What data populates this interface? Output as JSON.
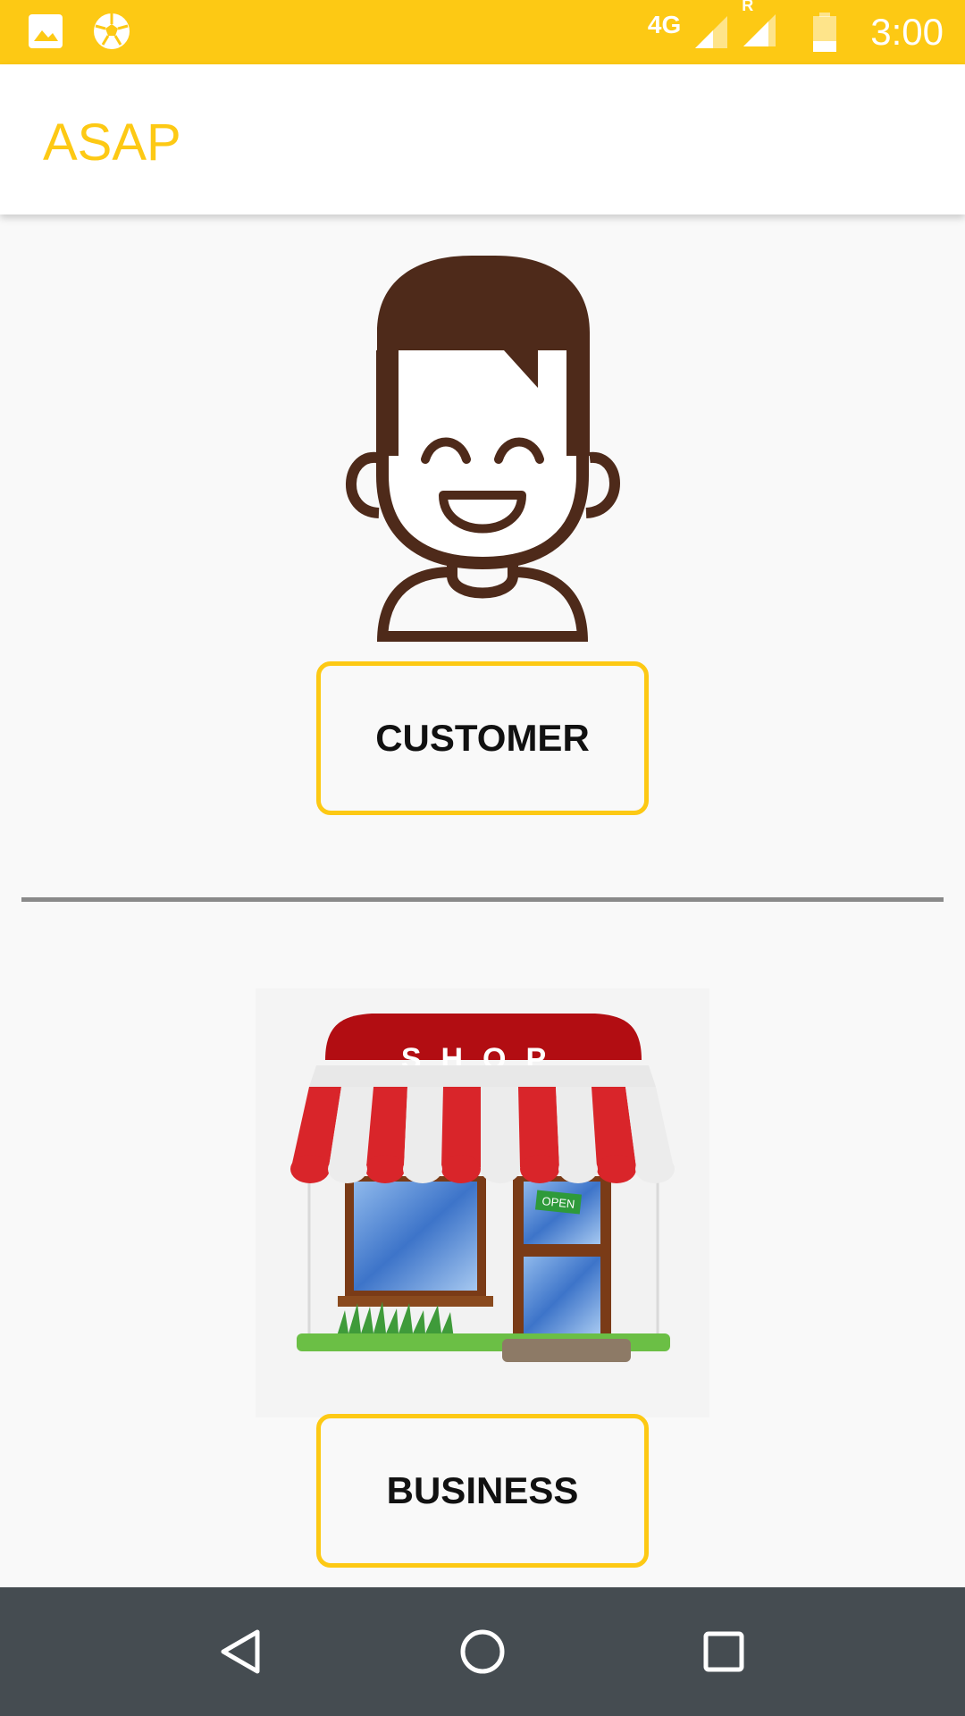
{
  "status_bar": {
    "network": "4G",
    "roaming": "R",
    "time": "3:00",
    "icons": [
      "image-icon",
      "soccer-ball-icon",
      "signal-icon",
      "roaming-signal-icon",
      "battery-icon"
    ]
  },
  "app_bar": {
    "title": "ASAP"
  },
  "customer": {
    "button_label": "CUSTOMER",
    "image": "customer-avatar-icon"
  },
  "business": {
    "button_label": "BUSINESS",
    "image": "shop-storefront-icon",
    "sign_text": "SHOP",
    "door_sign": "OPEN"
  },
  "nav_bar": {
    "buttons": [
      "back-icon",
      "home-icon",
      "recents-icon"
    ]
  },
  "colors": {
    "accent": "#fdc914",
    "nav": "#454c51",
    "hair": "#4e2a1a",
    "awning_red": "#c8141b"
  }
}
